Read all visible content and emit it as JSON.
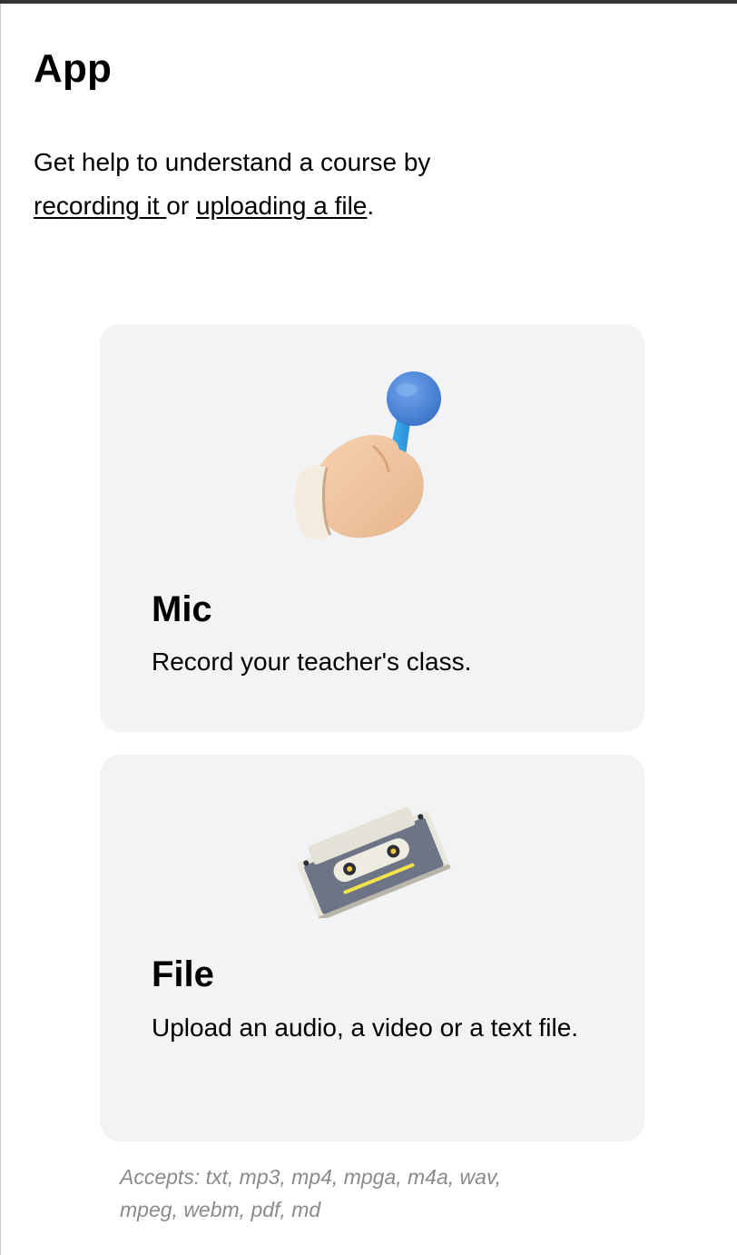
{
  "page": {
    "title": "App",
    "intro_prefix": "Get help to understand a course by ",
    "intro_link_record": "recording it ",
    "intro_middle": "or ",
    "intro_link_upload": "uploading a file",
    "intro_suffix": "."
  },
  "cards": {
    "mic": {
      "title": "Mic",
      "description": "Record your teacher's class.",
      "icon": "hand-holding-microphone-icon"
    },
    "file": {
      "title": "File",
      "description": "Upload an audio, a video or a text file.",
      "icon": "cassette-tape-icon"
    }
  },
  "accepts": "Accepts: txt, mp3, mp4, mpga, m4a, wav, mpeg, webm, pdf, md",
  "colors": {
    "card_background": "#f2f3f5",
    "accent_blue": "#4a8fe0",
    "muted_text": "#8a8a8a"
  }
}
